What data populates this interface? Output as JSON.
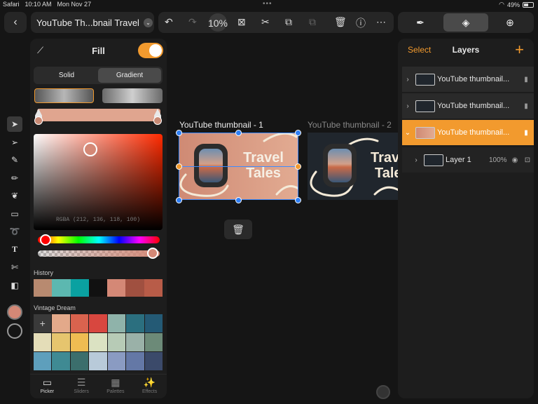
{
  "status": {
    "app": "Safari",
    "time": "10:10 AM",
    "date": "Mon Nov 27",
    "battery": "49%"
  },
  "toolbar": {
    "document_title": "YouTube Th...bnail Travel",
    "zoom": "10%"
  },
  "fill_panel": {
    "title": "Fill",
    "enabled": true,
    "tabs": [
      "Solid",
      "Gradient"
    ],
    "active_tab": "Gradient",
    "color_readout": "RGBA (212, 136, 118, 100)",
    "current_color": "#d48876",
    "history_label": "History",
    "history": [
      "#b88a70",
      "#5cb8b0",
      "#0aa1a1",
      "#111111",
      "#d48876",
      "#a05040",
      "#b85c48"
    ],
    "palette_label": "Vintage Dream",
    "palette": [
      "#e3a98a",
      "#d9634e",
      "#d8473f",
      "#8fb3aa",
      "#2b6f7f",
      "#245a75",
      "#e4ddb8",
      "#e6c56e",
      "#efbc52",
      "#dbe2c2",
      "#b7cbb6",
      "#9ab1a8",
      "#6c8a78",
      "#5e9fbc",
      "#3f8a93",
      "#3b6e6c",
      "#b8cad9",
      "#8a9bc2",
      "#6478a6",
      "#3b4a6a"
    ],
    "nav": [
      {
        "label": "Picker",
        "icon": "picker-icon"
      },
      {
        "label": "Sliders",
        "icon": "sliders-icon"
      },
      {
        "label": "Palettes",
        "icon": "palettes-icon"
      },
      {
        "label": "Effects",
        "icon": "effects-icon"
      }
    ],
    "active_nav": "Picker"
  },
  "canvas": {
    "artboards": [
      {
        "label": "YouTube thumbnail - 1",
        "text_line1": "Travel",
        "text_line2": "Tales"
      },
      {
        "label": "YouTube thumbnail - 2",
        "text_line1": "Trav",
        "text_line2": "Tale"
      }
    ]
  },
  "layers_panel": {
    "select_label": "Select",
    "title": "Layers",
    "rows": [
      {
        "name": "YouTube thumbnail...",
        "selected": false,
        "expanded": false
      },
      {
        "name": "YouTube thumbnail...",
        "selected": false,
        "expanded": false
      },
      {
        "name": "YouTube thumbnail...",
        "selected": true,
        "expanded": true
      }
    ],
    "child": {
      "name": "Layer 1",
      "opacity": "100%"
    }
  },
  "colors": {
    "accent": "#f29a2e",
    "selection": "#2f7ff5"
  }
}
